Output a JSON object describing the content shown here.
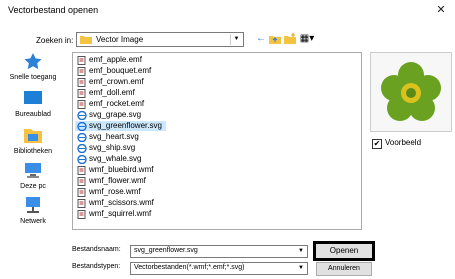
{
  "window": {
    "title": "Vectorbestand openen",
    "close_glyph": "✕"
  },
  "lookin": {
    "label": "Zoeken in:",
    "value": "Vector Image"
  },
  "toolbar": {
    "back": "←",
    "up": "⬑",
    "new_folder": "✱",
    "views": "▦▾"
  },
  "places": [
    {
      "label": "Snelle toegang",
      "icon": "star-icon"
    },
    {
      "label": "Bureaublad",
      "icon": "desktop-icon"
    },
    {
      "label": "Bibliotheken",
      "icon": "library-icon"
    },
    {
      "label": "Deze pc",
      "icon": "computer-icon"
    },
    {
      "label": "Netwerk",
      "icon": "network-icon"
    }
  ],
  "files": [
    {
      "name": "emf_apple.emf",
      "type": "emf"
    },
    {
      "name": "emf_bouquet.emf",
      "type": "emf"
    },
    {
      "name": "emf_crown.emf",
      "type": "emf"
    },
    {
      "name": "emf_doll.emf",
      "type": "emf"
    },
    {
      "name": "emf_rocket.emf",
      "type": "emf"
    },
    {
      "name": "svg_grape.svg",
      "type": "svg"
    },
    {
      "name": "svg_greenflower.svg",
      "type": "svg",
      "selected": true
    },
    {
      "name": "svg_heart.svg",
      "type": "svg"
    },
    {
      "name": "svg_ship.svg",
      "type": "svg"
    },
    {
      "name": "svg_whale.svg",
      "type": "svg"
    },
    {
      "name": "wmf_bluebird.wmf",
      "type": "wmf"
    },
    {
      "name": "wmf_flower.wmf",
      "type": "wmf"
    },
    {
      "name": "wmf_rose.wmf",
      "type": "wmf"
    },
    {
      "name": "wmf_scissors.wmf",
      "type": "wmf"
    },
    {
      "name": "wmf_squirrel.wmf",
      "type": "wmf"
    }
  ],
  "filename": {
    "label": "Bestandsnaam:",
    "value": "svg_greenflower.svg"
  },
  "filetype": {
    "label": "Bestandstypen:",
    "value": "Vectorbestanden(*.wmf;*.emf;*.svg)"
  },
  "buttons": {
    "open": "Openen",
    "cancel": "Annuleren"
  },
  "preview": {
    "checkbox_label": "Voorbeeld",
    "checked": true,
    "check_glyph": "✔"
  },
  "colors": {
    "selection": "#cce8ff",
    "folder": "#f5c342",
    "flower_petal": "#6aa121",
    "flower_center": "#d9c21b"
  }
}
